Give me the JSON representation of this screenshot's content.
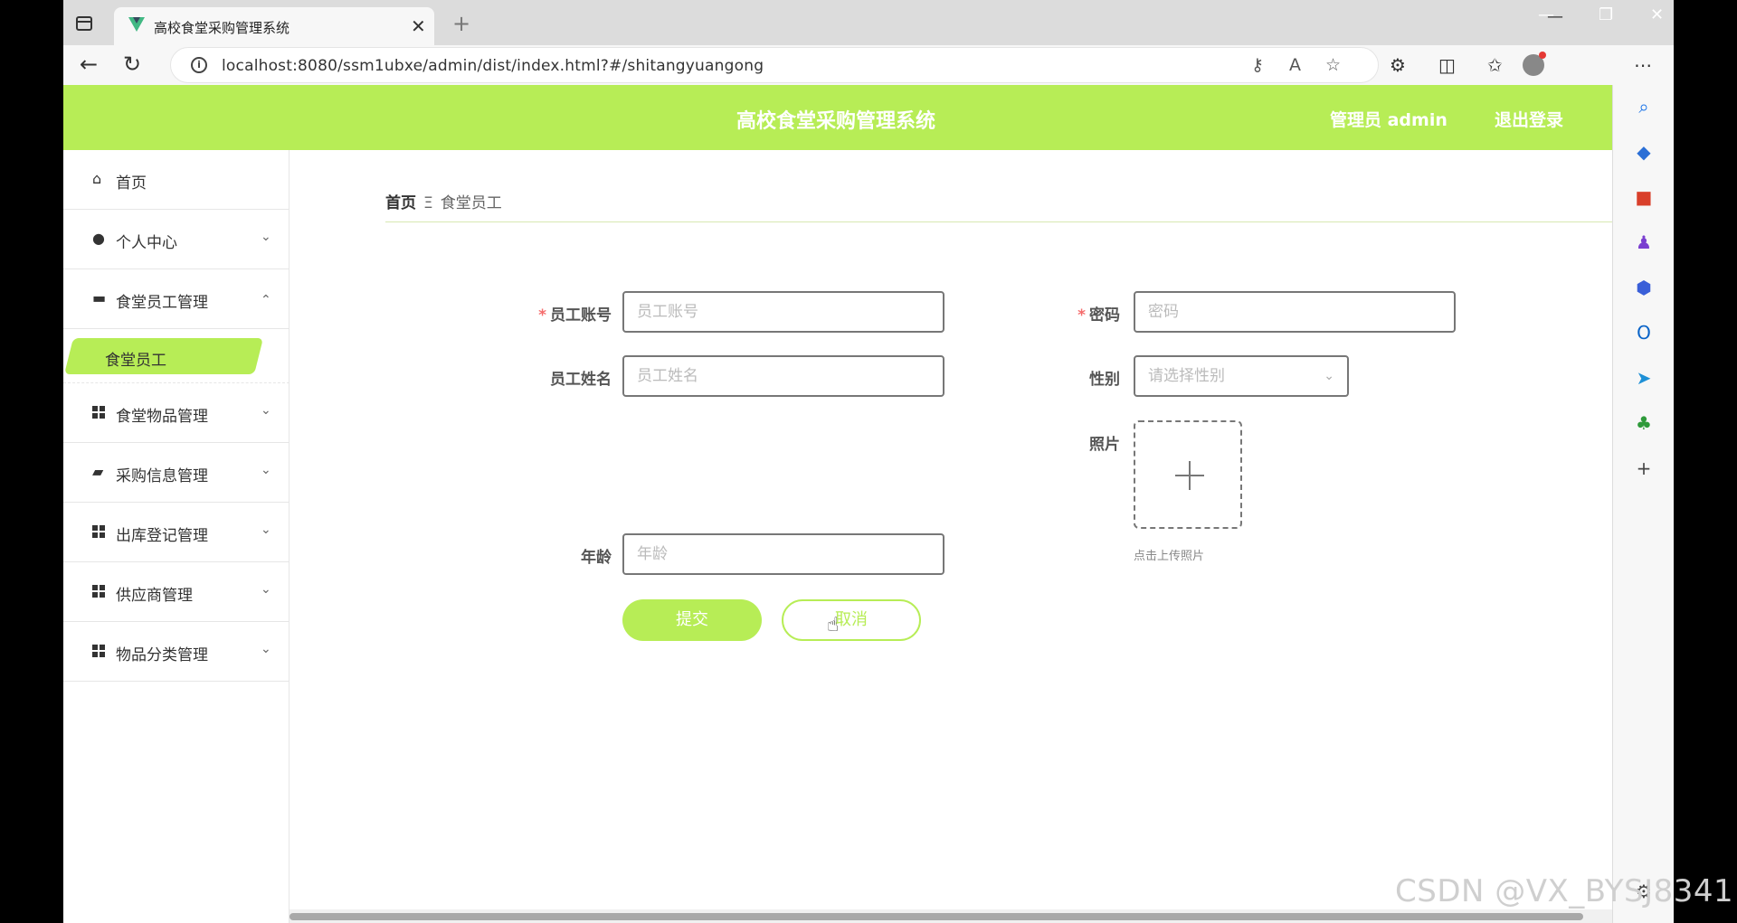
{
  "browser": {
    "tab_title": "高校食堂采购管理系统",
    "tab_close": "✕",
    "new_tab": "+",
    "url": "localhost:8080/ssm1ubxe/admin/dist/index.html?#/shitangyuangong",
    "window_controls": [
      "—",
      "❐",
      "✕"
    ]
  },
  "header": {
    "title": "高校食堂采购管理系统",
    "user": "管理员 admin",
    "logout": "退出登录"
  },
  "sidebar": {
    "items": [
      {
        "label": "首页",
        "icon": "home-icon"
      },
      {
        "label": "个人中心",
        "icon": "user-icon"
      },
      {
        "label": "食堂员工管理",
        "icon": "briefcase-icon"
      },
      {
        "label": "食堂物品管理",
        "icon": "grid-icon"
      },
      {
        "label": "采购信息管理",
        "icon": "wallet-icon"
      },
      {
        "label": "出库登记管理",
        "icon": "grid-icon"
      },
      {
        "label": "供应商管理",
        "icon": "grid-icon"
      },
      {
        "label": "物品分类管理",
        "icon": "grid-icon"
      }
    ],
    "submenu_active": "食堂员工"
  },
  "breadcrumb": {
    "home": "首页",
    "separator": "Ξ",
    "current": "食堂员工"
  },
  "form": {
    "account_label": "员工账号",
    "account_placeholder": "员工账号",
    "password_label": "密码",
    "password_placeholder": "密码",
    "name_label": "员工姓名",
    "name_placeholder": "员工姓名",
    "gender_label": "性别",
    "gender_placeholder": "请选择性别",
    "photo_label": "照片",
    "photo_tip": "点击上传照片",
    "age_label": "年龄",
    "age_placeholder": "年龄",
    "required_mark": "*",
    "submit": "提交",
    "cancel": "取消"
  },
  "watermark": "CSDN @VX_BYSJ8341",
  "colors": {
    "accent": "#b7ed56",
    "required": "#f56c6c"
  }
}
